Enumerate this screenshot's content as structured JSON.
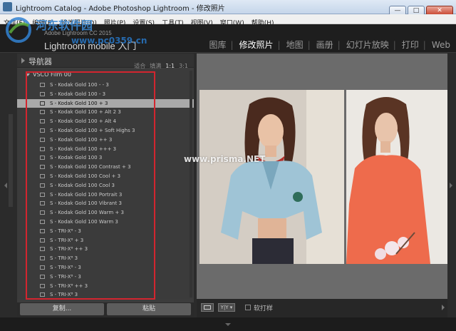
{
  "window": {
    "title": "Lightroom Catalog - Adobe Photoshop Lightroom - 修改照片",
    "minimize": "—",
    "maximize": "□",
    "close": "✕"
  },
  "menubar": {
    "items": [
      "文件(F)",
      "编辑(E)",
      "修改照片(D)",
      "照片(P)",
      "设置(S)",
      "工具(T)",
      "视图(V)",
      "窗口(W)",
      "帮助(H)"
    ]
  },
  "identity": {
    "small": "Adobe Lightroom CC 2015",
    "big": "Lightroom mobile 入门"
  },
  "modules": [
    "图库",
    "修改照片",
    "地图",
    "画册",
    "幻灯片放映",
    "打印",
    "Web"
  ],
  "active_module": "修改照片",
  "navigator": {
    "title": "导航器",
    "zoom_options": [
      "适合",
      "填满",
      "1:1",
      "3:1"
    ],
    "active_zoom": "1:1"
  },
  "presets": {
    "folder": "VSCO Film 00",
    "items": [
      "S - Kodak Gold 100 - - 3",
      "S - Kodak Gold 100 - 3",
      "S - Kodak Gold 100 + 3",
      "S - Kodak Gold 100 + Alt 2 3",
      "S - Kodak Gold 100 + Alt 4",
      "S - Kodak Gold 100 + Soft Highs 3",
      "S - Kodak Gold 100 ++ 3",
      "S - Kodak Gold 100 +++ 3",
      "S - Kodak Gold 100 3",
      "S - Kodak Gold 100 Contrast + 3",
      "S - Kodak Gold 100 Cool + 3",
      "S - Kodak Gold 100 Cool 3",
      "S - Kodak Gold 100 Portrait 3",
      "S - Kodak Gold 100 Vibrant 3",
      "S - Kodak Gold 100 Warm + 3",
      "S - Kodak Gold 100 Warm 3",
      "S - TRI-X⁸ - 3",
      "S - TRI-X⁸ + 3",
      "S - TRI-X⁸ ++ 3",
      "S - TRI-X⁸ 3",
      "S - TRI-X⁸ - 3",
      "S - TRI-X⁸ - 3",
      "S - TRI-X⁸ ++ 3",
      "S - TRI-X⁸ 3"
    ],
    "selected_index": 2
  },
  "left_buttons": {
    "copy": "复制...",
    "paste": "粘贴"
  },
  "toolbar": {
    "yy": "Y|Y ▾",
    "softproof": "软打样"
  },
  "watermarks": {
    "logo_text": "河东软件园",
    "url": "www.pc0359.cn",
    "photo_text": "www.prisma.NET"
  },
  "colors": {
    "highlight": "#d3252f",
    "selected_row": "#a9a9a9",
    "active_module": "#ffffff"
  }
}
